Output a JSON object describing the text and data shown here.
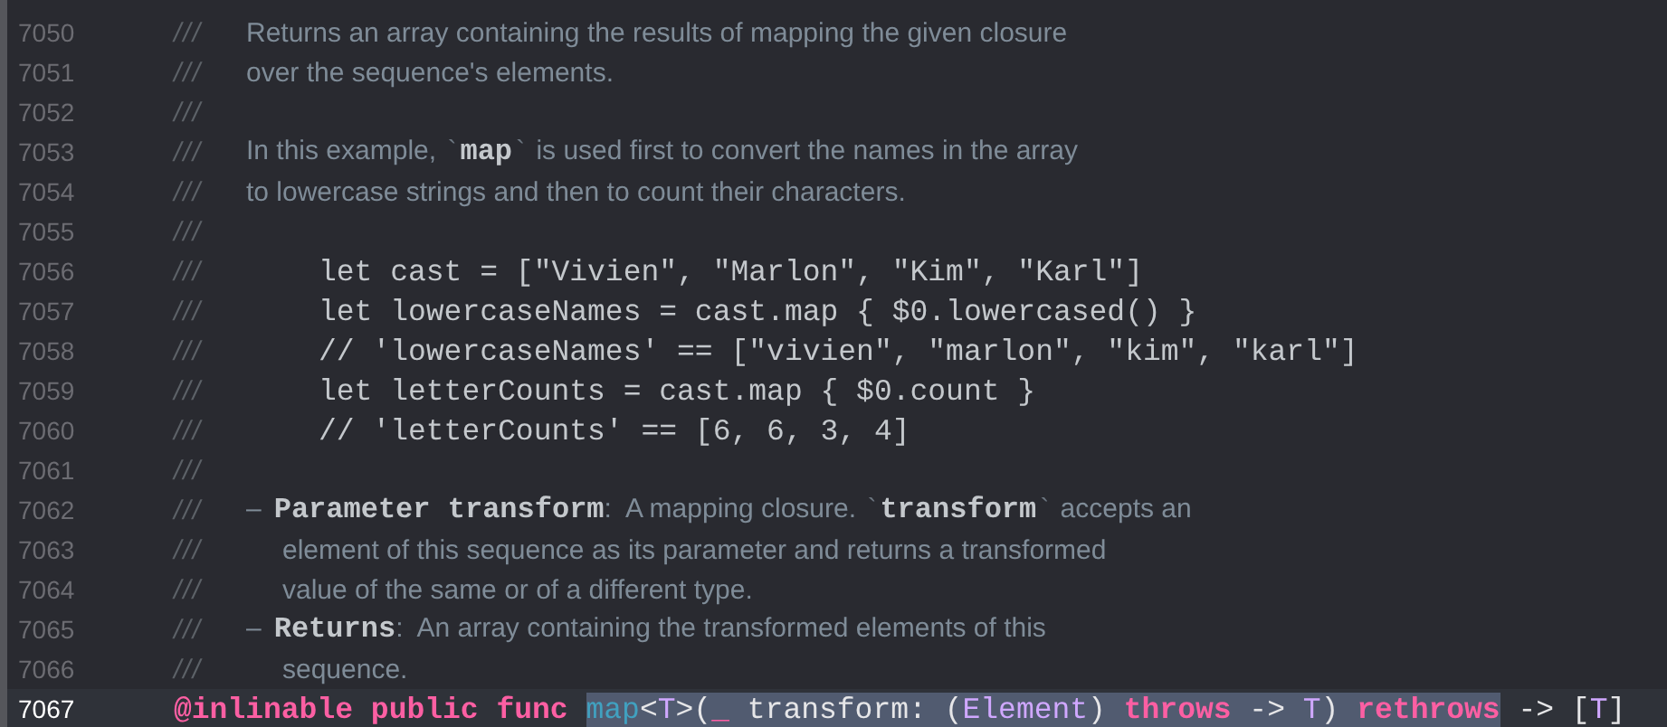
{
  "lines": [
    {
      "number": "7050",
      "current": false,
      "indent": false,
      "marker": "///",
      "segments": [
        {
          "kind": "prose",
          "text": "Returns an array containing the results of mapping the given closure"
        }
      ]
    },
    {
      "number": "7051",
      "current": false,
      "indent": false,
      "marker": "///",
      "segments": [
        {
          "kind": "prose",
          "text": "over the sequence's elements."
        }
      ]
    },
    {
      "number": "7052",
      "current": false,
      "marker": "///"
    },
    {
      "number": "7053",
      "current": false,
      "indent": false,
      "marker": "///",
      "segments": [
        {
          "kind": "prose",
          "text": "In this example, "
        },
        {
          "kind": "tick",
          "text": "`"
        },
        {
          "kind": "strong",
          "text": "map"
        },
        {
          "kind": "tick",
          "text": "`"
        },
        {
          "kind": "prose",
          "text": " is used first to convert the names in the array"
        }
      ]
    },
    {
      "number": "7054",
      "current": false,
      "indent": false,
      "marker": "///",
      "segments": [
        {
          "kind": "prose",
          "text": "to lowercase strings and then to count their characters."
        }
      ]
    },
    {
      "number": "7055",
      "current": false,
      "marker": "///"
    },
    {
      "number": "7056",
      "current": false,
      "indent": false,
      "marker": "///",
      "segments": [
        {
          "kind": "code",
          "text": "let cast = [\"Vivien\", \"Marlon\", \"Kim\", \"Karl\"]"
        }
      ]
    },
    {
      "number": "7057",
      "current": false,
      "indent": false,
      "marker": "///",
      "segments": [
        {
          "kind": "code",
          "text": "let lowercaseNames = cast.map { $0.lowercased() }"
        }
      ]
    },
    {
      "number": "7058",
      "current": false,
      "indent": false,
      "marker": "///",
      "segments": [
        {
          "kind": "code",
          "text": "// 'lowercaseNames' == [\"vivien\", \"marlon\", \"kim\", \"karl\"]"
        }
      ]
    },
    {
      "number": "7059",
      "current": false,
      "indent": false,
      "marker": "///",
      "segments": [
        {
          "kind": "code",
          "text": "let letterCounts = cast.map { $0.count }"
        }
      ]
    },
    {
      "number": "7060",
      "current": false,
      "indent": false,
      "marker": "///",
      "segments": [
        {
          "kind": "code",
          "text": "// 'letterCounts' == [6, 6, 3, 4]"
        }
      ]
    },
    {
      "number": "7061",
      "current": false,
      "marker": "///"
    },
    {
      "number": "7062",
      "current": false,
      "indent": false,
      "marker": "///",
      "segments": [
        {
          "kind": "dash",
          "text": "–"
        },
        {
          "kind": "strong",
          "text": "Parameter transform"
        },
        {
          "kind": "prose",
          "text": ":  A mapping closure. "
        },
        {
          "kind": "tick",
          "text": "`"
        },
        {
          "kind": "strong",
          "text": "transform"
        },
        {
          "kind": "tick",
          "text": "`"
        },
        {
          "kind": "prose",
          "text": " accepts an"
        }
      ]
    },
    {
      "number": "7063",
      "current": false,
      "indent": true,
      "marker": "///",
      "segments": [
        {
          "kind": "prose",
          "text": "element of this sequence as its parameter and returns a transformed"
        }
      ]
    },
    {
      "number": "7064",
      "current": false,
      "indent": true,
      "marker": "///",
      "segments": [
        {
          "kind": "prose",
          "text": "value of the same or of a different type."
        }
      ]
    },
    {
      "number": "7065",
      "current": false,
      "indent": false,
      "marker": "///",
      "segments": [
        {
          "kind": "dash",
          "text": "–"
        },
        {
          "kind": "strong",
          "text": "Returns"
        },
        {
          "kind": "prose",
          "text": ":  An array containing the transformed elements of this"
        }
      ]
    },
    {
      "number": "7066",
      "current": false,
      "indent": true,
      "marker": "///",
      "segments": [
        {
          "kind": "prose",
          "text": "sequence."
        }
      ]
    },
    {
      "number": "7067",
      "current": true,
      "indent": false,
      "segments": [
        {
          "kind": "keyword",
          "text": "@inlinable public func ",
          "selected": false
        },
        {
          "kind": "name",
          "text": "map",
          "selected": true
        },
        {
          "kind": "plain",
          "text": "<",
          "selected": true
        },
        {
          "kind": "type",
          "text": "T",
          "selected": true
        },
        {
          "kind": "plain",
          "text": ">(",
          "selected": true
        },
        {
          "kind": "keyword",
          "text": "_",
          "selected": true
        },
        {
          "kind": "plain",
          "text": " transform: (",
          "selected": true
        },
        {
          "kind": "type",
          "text": "Element",
          "selected": true
        },
        {
          "kind": "plain",
          "text": ") ",
          "selected": true
        },
        {
          "kind": "keyword",
          "text": "throws",
          "selected": true
        },
        {
          "kind": "plain",
          "text": " -> ",
          "selected": true
        },
        {
          "kind": "type",
          "text": "T",
          "selected": true
        },
        {
          "kind": "plain",
          "text": ") ",
          "selected": true
        },
        {
          "kind": "keyword",
          "text": "rethrows",
          "selected": true
        },
        {
          "kind": "plain",
          "text": " -> [",
          "selected": false
        },
        {
          "kind": "type",
          "text": "T",
          "selected": false
        },
        {
          "kind": "plain",
          "text": "]",
          "selected": false
        }
      ]
    }
  ]
}
